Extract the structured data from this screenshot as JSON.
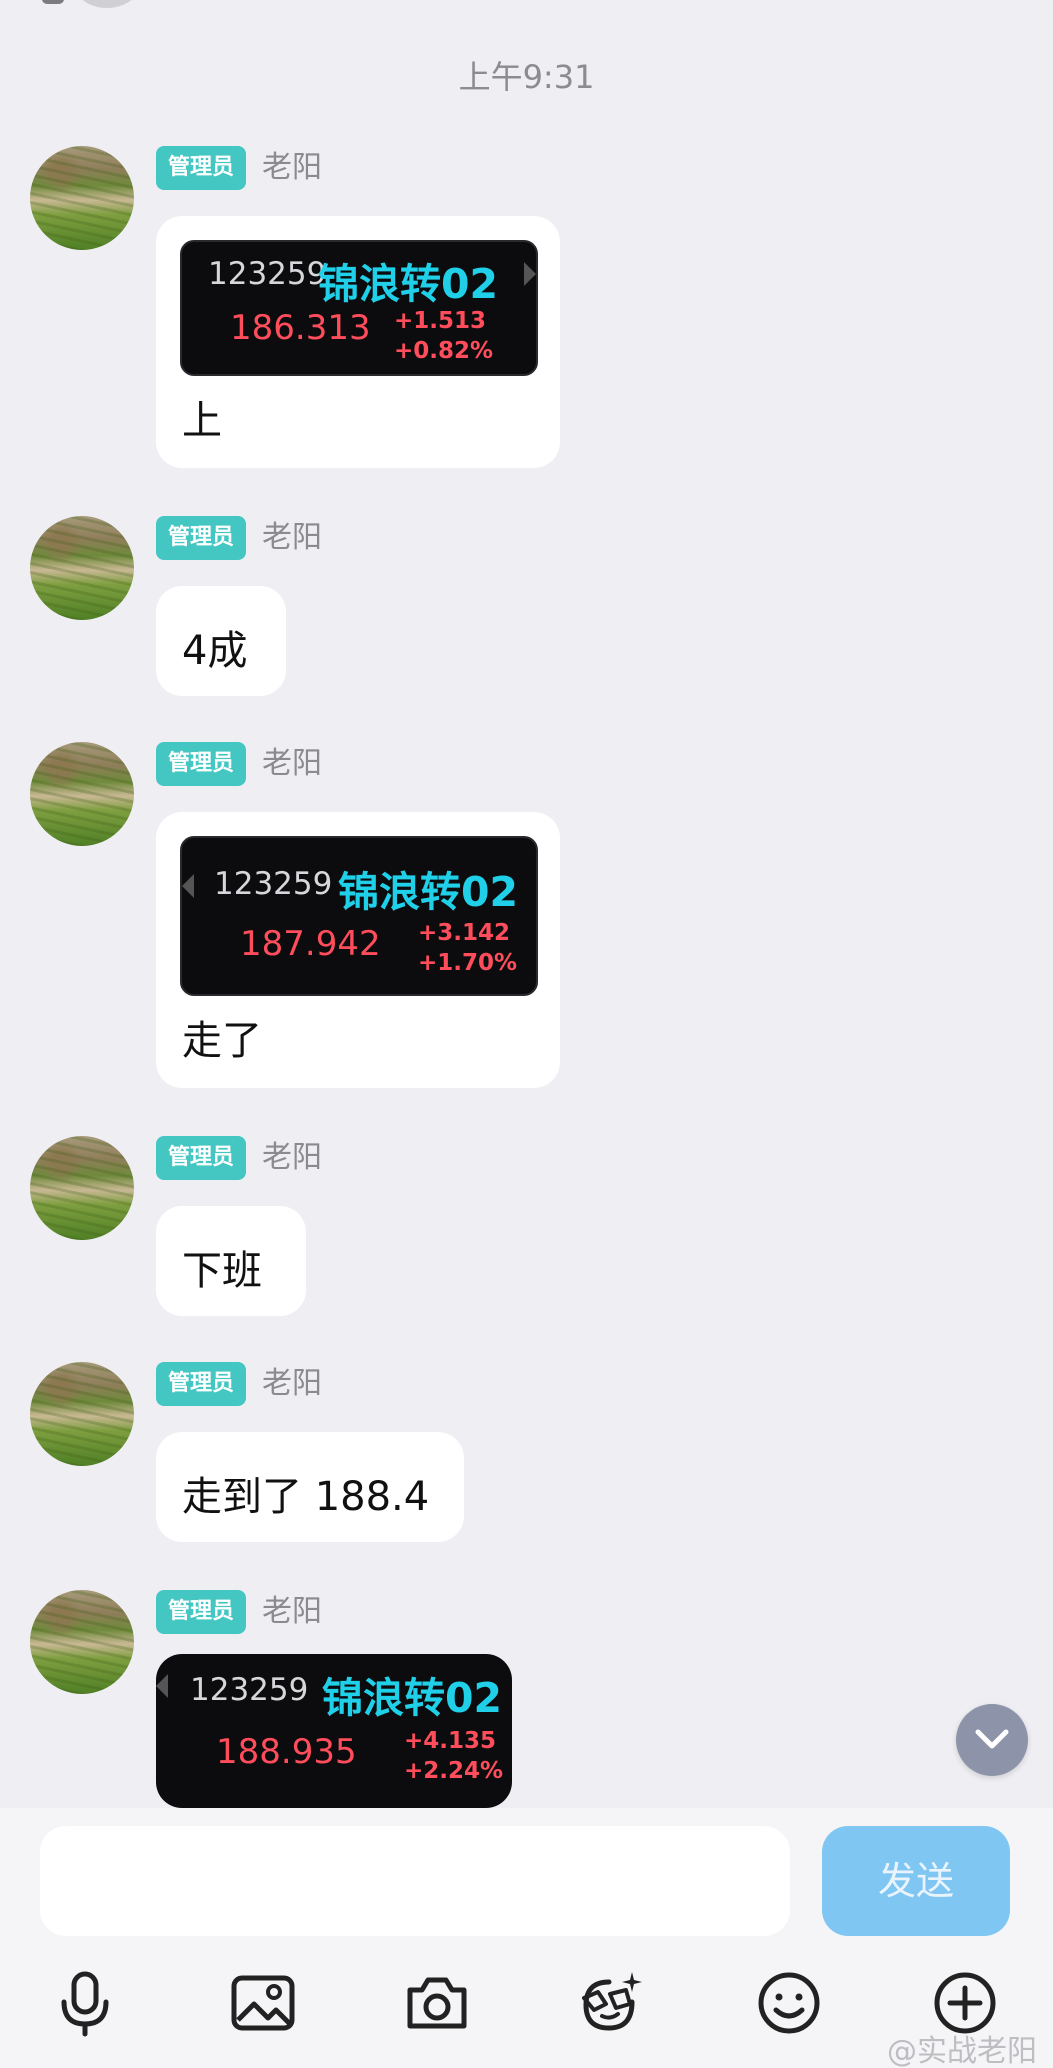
{
  "time_divider": "上午9:31",
  "sender": {
    "role_badge": "管理员",
    "name": "老阳"
  },
  "messages": [
    {
      "type": "image+text",
      "stock": {
        "code": "123259",
        "name": "锦浪转02",
        "price": "186.313",
        "change": "+1.513",
        "change_pct": "+0.82%"
      },
      "text": "上"
    },
    {
      "type": "text",
      "text": "4成"
    },
    {
      "type": "image+text",
      "stock": {
        "code": "123259",
        "name": "锦浪转02",
        "price": "187.942",
        "change": "+3.142",
        "change_pct": "+1.70%"
      },
      "text": "走了"
    },
    {
      "type": "text",
      "text": "下班"
    },
    {
      "type": "text",
      "text": "走到了 188.4"
    },
    {
      "type": "image",
      "stock": {
        "code": "123259",
        "name": "锦浪转02",
        "price": "188.935",
        "change": "+4.135",
        "change_pct": "+2.24%"
      }
    }
  ],
  "composer": {
    "placeholder": "",
    "send_label": "发送"
  },
  "toolbar_icons": [
    "microphone-icon",
    "image-icon",
    "camera-icon",
    "sticker-icon",
    "emoji-icon",
    "plus-icon"
  ],
  "watermark": "@实战老阳",
  "colors": {
    "badge": "#44c7c3",
    "stock_name": "#1fd0e8",
    "price_up": "#ff4d5c",
    "send_button": "#7fc6f3"
  }
}
